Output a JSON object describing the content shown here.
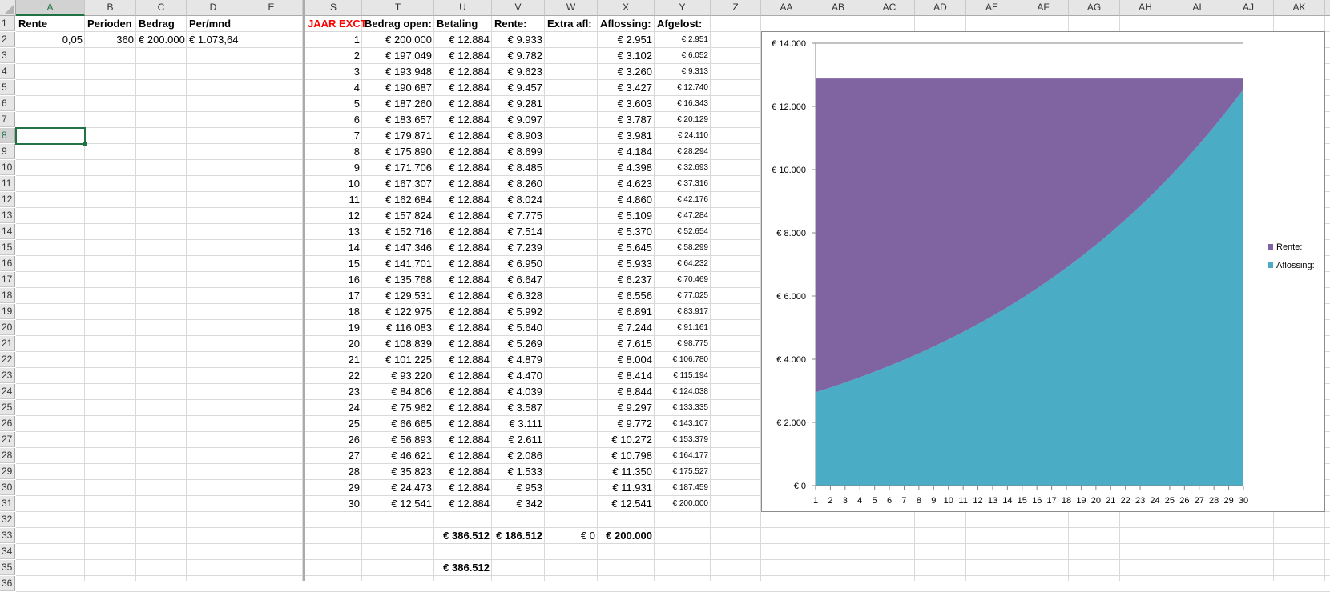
{
  "sheet": {
    "columns": [
      "A",
      "B",
      "C",
      "D",
      "E",
      "S",
      "T",
      "U",
      "V",
      "W",
      "X",
      "Y",
      "Z",
      "AA",
      "AB",
      "AC",
      "AD",
      "AE",
      "AF",
      "AG",
      "AH",
      "AI",
      "AJ",
      "AK"
    ],
    "row_numbers": [
      "1",
      "2",
      "3",
      "4",
      "5",
      "6",
      "7",
      "8",
      "9",
      "10",
      "11",
      "12",
      "13",
      "14",
      "15",
      "16",
      "17",
      "18",
      "19",
      "20",
      "21",
      "22",
      "23",
      "24",
      "25",
      "26",
      "27",
      "28",
      "29",
      "30",
      "31",
      "32",
      "33",
      "34",
      "35",
      "36"
    ],
    "selected_cell": "A8"
  },
  "inputs": {
    "headers": {
      "A": "Rente",
      "B": "Perioden",
      "C": "Bedrag",
      "D": "Per/mnd"
    },
    "values": {
      "A": "0,05",
      "B": "360",
      "C": "€ 200.000",
      "D": "€ 1.073,64"
    }
  },
  "table": {
    "headers": {
      "S": "JAAR EXCT",
      "T": "Bedrag open:",
      "U": "Betaling",
      "V": "Rente:",
      "W": "Extra afl:",
      "X": "Aflossing:",
      "Y": "Afgelost:"
    },
    "header_color": "#ff0000",
    "rows": [
      [
        "1",
        "€ 200.000",
        "€ 12.884",
        "€ 9.933",
        "",
        "€ 2.951",
        "€ 2.951"
      ],
      [
        "2",
        "€ 197.049",
        "€ 12.884",
        "€ 9.782",
        "",
        "€ 3.102",
        "€ 6.052"
      ],
      [
        "3",
        "€ 193.948",
        "€ 12.884",
        "€ 9.623",
        "",
        "€ 3.260",
        "€ 9.313"
      ],
      [
        "4",
        "€ 190.687",
        "€ 12.884",
        "€ 9.457",
        "",
        "€ 3.427",
        "€ 12.740"
      ],
      [
        "5",
        "€ 187.260",
        "€ 12.884",
        "€ 9.281",
        "",
        "€ 3.603",
        "€ 16.343"
      ],
      [
        "6",
        "€ 183.657",
        "€ 12.884",
        "€ 9.097",
        "",
        "€ 3.787",
        "€ 20.129"
      ],
      [
        "7",
        "€ 179.871",
        "€ 12.884",
        "€ 8.903",
        "",
        "€ 3.981",
        "€ 24.110"
      ],
      [
        "8",
        "€ 175.890",
        "€ 12.884",
        "€ 8.699",
        "",
        "€ 4.184",
        "€ 28.294"
      ],
      [
        "9",
        "€ 171.706",
        "€ 12.884",
        "€ 8.485",
        "",
        "€ 4.398",
        "€ 32.693"
      ],
      [
        "10",
        "€ 167.307",
        "€ 12.884",
        "€ 8.260",
        "",
        "€ 4.623",
        "€ 37.316"
      ],
      [
        "11",
        "€ 162.684",
        "€ 12.884",
        "€ 8.024",
        "",
        "€ 4.860",
        "€ 42.176"
      ],
      [
        "12",
        "€ 157.824",
        "€ 12.884",
        "€ 7.775",
        "",
        "€ 5.109",
        "€ 47.284"
      ],
      [
        "13",
        "€ 152.716",
        "€ 12.884",
        "€ 7.514",
        "",
        "€ 5.370",
        "€ 52.654"
      ],
      [
        "14",
        "€ 147.346",
        "€ 12.884",
        "€ 7.239",
        "",
        "€ 5.645",
        "€ 58.299"
      ],
      [
        "15",
        "€ 141.701",
        "€ 12.884",
        "€ 6.950",
        "",
        "€ 5.933",
        "€ 64.232"
      ],
      [
        "16",
        "€ 135.768",
        "€ 12.884",
        "€ 6.647",
        "",
        "€ 6.237",
        "€ 70.469"
      ],
      [
        "17",
        "€ 129.531",
        "€ 12.884",
        "€ 6.328",
        "",
        "€ 6.556",
        "€ 77.025"
      ],
      [
        "18",
        "€ 122.975",
        "€ 12.884",
        "€ 5.992",
        "",
        "€ 6.891",
        "€ 83.917"
      ],
      [
        "19",
        "€ 116.083",
        "€ 12.884",
        "€ 5.640",
        "",
        "€ 7.244",
        "€ 91.161"
      ],
      [
        "20",
        "€ 108.839",
        "€ 12.884",
        "€ 5.269",
        "",
        "€ 7.615",
        "€ 98.775"
      ],
      [
        "21",
        "€ 101.225",
        "€ 12.884",
        "€ 4.879",
        "",
        "€ 8.004",
        "€ 106.780"
      ],
      [
        "22",
        "€ 93.220",
        "€ 12.884",
        "€ 4.470",
        "",
        "€ 8.414",
        "€ 115.194"
      ],
      [
        "23",
        "€ 84.806",
        "€ 12.884",
        "€ 4.039",
        "",
        "€ 8.844",
        "€ 124.038"
      ],
      [
        "24",
        "€ 75.962",
        "€ 12.884",
        "€ 3.587",
        "",
        "€ 9.297",
        "€ 133.335"
      ],
      [
        "25",
        "€ 66.665",
        "€ 12.884",
        "€ 3.111",
        "",
        "€ 9.772",
        "€ 143.107"
      ],
      [
        "26",
        "€ 56.893",
        "€ 12.884",
        "€ 2.611",
        "",
        "€ 10.272",
        "€ 153.379"
      ],
      [
        "27",
        "€ 46.621",
        "€ 12.884",
        "€ 2.086",
        "",
        "€ 10.798",
        "€ 164.177"
      ],
      [
        "28",
        "€ 35.823",
        "€ 12.884",
        "€ 1.533",
        "",
        "€ 11.350",
        "€ 175.527"
      ],
      [
        "29",
        "€ 24.473",
        "€ 12.884",
        "€ 953",
        "",
        "€ 11.931",
        "€ 187.459"
      ],
      [
        "30",
        "€ 12.541",
        "€ 12.884",
        "€ 342",
        "",
        "€ 12.541",
        "€ 200.000"
      ]
    ]
  },
  "totals": {
    "betaling": "€ 386.512",
    "rente": "€ 186.512",
    "extra": "€ 0",
    "aflossing": "€ 200.000",
    "betaling_check": "€ 386.512"
  },
  "chart_data": {
    "type": "area",
    "stacked": true,
    "title": "",
    "xlabel": "",
    "ylabel": "",
    "categories": [
      "1",
      "2",
      "3",
      "4",
      "5",
      "6",
      "7",
      "8",
      "9",
      "10",
      "11",
      "12",
      "13",
      "14",
      "15",
      "16",
      "17",
      "18",
      "19",
      "20",
      "21",
      "22",
      "23",
      "24",
      "25",
      "26",
      "27",
      "28",
      "29",
      "30"
    ],
    "ylim": [
      0,
      14000
    ],
    "ytick_labels": [
      "€ 0",
      "€ 2.000",
      "€ 4.000",
      "€ 6.000",
      "€ 8.000",
      "€ 10.000",
      "€ 12.000",
      "€ 14.000"
    ],
    "yticks": [
      0,
      2000,
      4000,
      6000,
      8000,
      10000,
      12000,
      14000
    ],
    "legend_position": "right",
    "series": [
      {
        "name": "Aflossing:",
        "color": "#4bacc6",
        "values": [
          2951,
          3102,
          3260,
          3427,
          3603,
          3787,
          3981,
          4184,
          4398,
          4623,
          4860,
          5109,
          5370,
          5645,
          5933,
          6237,
          6556,
          6891,
          7244,
          7615,
          8004,
          8414,
          8844,
          9297,
          9772,
          10272,
          10798,
          11350,
          11931,
          12541
        ]
      },
      {
        "name": "Rente:",
        "color": "#8064a2",
        "values": [
          9933,
          9782,
          9623,
          9457,
          9281,
          9097,
          8903,
          8699,
          8485,
          8260,
          8024,
          7775,
          7514,
          7239,
          6950,
          6647,
          6328,
          5992,
          5640,
          5269,
          4879,
          4470,
          4039,
          3587,
          3111,
          2611,
          2086,
          1533,
          953,
          342
        ]
      }
    ]
  }
}
